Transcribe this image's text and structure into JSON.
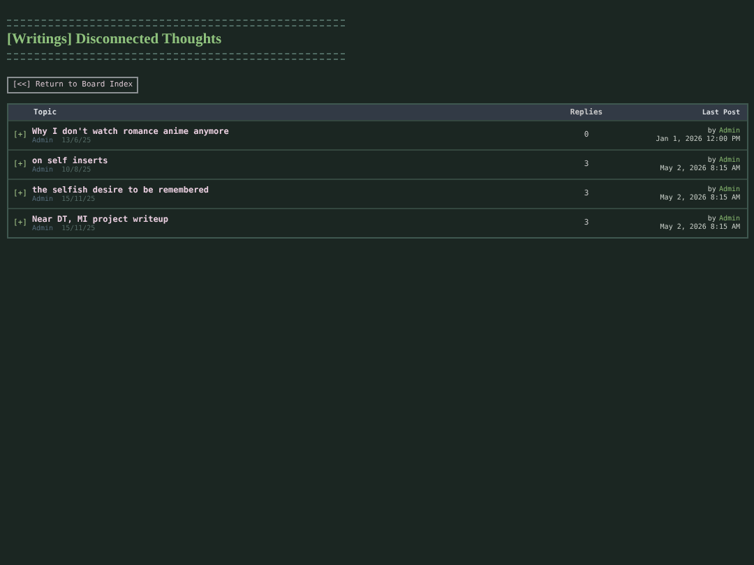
{
  "board": {
    "title": "[Writings] Disconnected Thoughts",
    "back_link": "[<<] Return to Board Index"
  },
  "table": {
    "columns": [
      "Topic",
      "Replies",
      "Last Post"
    ],
    "rows": [
      {
        "marker": "[+]",
        "title": "Why I don't watch romance anime anymore",
        "author": "Admin",
        "date": "13/6/25",
        "replies": "0",
        "last_by": "by",
        "last_author": "Admin",
        "last_time": "Jan 1, 2026 12:00 PM"
      },
      {
        "marker": "[+]",
        "title": "on self inserts",
        "author": "Admin",
        "date": "10/8/25",
        "replies": "3",
        "last_by": "by",
        "last_author": "Admin",
        "last_time": "May 2, 2026 8:15 AM"
      },
      {
        "marker": "[+]",
        "title": "the selfish desire to be remembered",
        "author": "Admin",
        "date": "15/11/25",
        "replies": "3",
        "last_by": "by",
        "last_author": "Admin",
        "last_time": "May 2, 2026 8:15 AM"
      },
      {
        "marker": "[+]",
        "title": "Near DT, MI project writeup",
        "author": "Admin",
        "date": "15/11/25",
        "replies": "3",
        "last_by": "by",
        "last_author": "Admin",
        "last_time": "May 2, 2026 8:15 AM"
      }
    ]
  }
}
